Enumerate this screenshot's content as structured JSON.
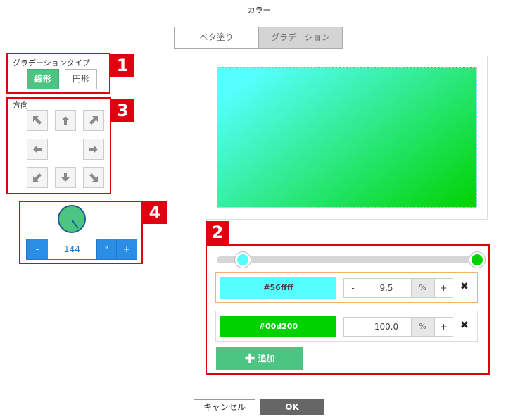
{
  "dialog": {
    "title": "カラー"
  },
  "tabs": [
    {
      "label": "ベタ塗り",
      "active": false
    },
    {
      "label": "グラデーション",
      "active": true
    }
  ],
  "badges": [
    "1",
    "2",
    "3",
    "4"
  ],
  "gradient_type": {
    "label": "グラデーションタイプ",
    "options": [
      {
        "label": "線形",
        "selected": true
      },
      {
        "label": "円形",
        "selected": false
      }
    ]
  },
  "direction": {
    "label": "方向",
    "buttons": [
      "arrow-up-left-icon",
      "arrow-up-icon",
      "arrow-up-right-icon",
      "arrow-left-icon",
      "arrow-right-icon",
      "arrow-down-left-icon",
      "arrow-down-icon",
      "arrow-down-right-icon"
    ]
  },
  "angle": {
    "minus": "-",
    "value": "144",
    "unit": "°",
    "plus": "+"
  },
  "stops": [
    {
      "color": "#56ffff",
      "position": "9.5",
      "unit": "%",
      "minus": "-",
      "plus": "+",
      "delete": "✖",
      "selected": true
    },
    {
      "color": "#00d200",
      "position": "100.0",
      "unit": "%",
      "minus": "-",
      "plus": "+",
      "delete": "✖",
      "selected": false
    }
  ],
  "add_button": {
    "icon": "plus-icon",
    "label": "追加"
  },
  "footer": {
    "cancel": "キャンセル",
    "ok": "OK"
  },
  "colors": {
    "accent_green": "#4cc582",
    "accent_blue": "#2a8ee6",
    "annotation_red": "#e00010"
  }
}
